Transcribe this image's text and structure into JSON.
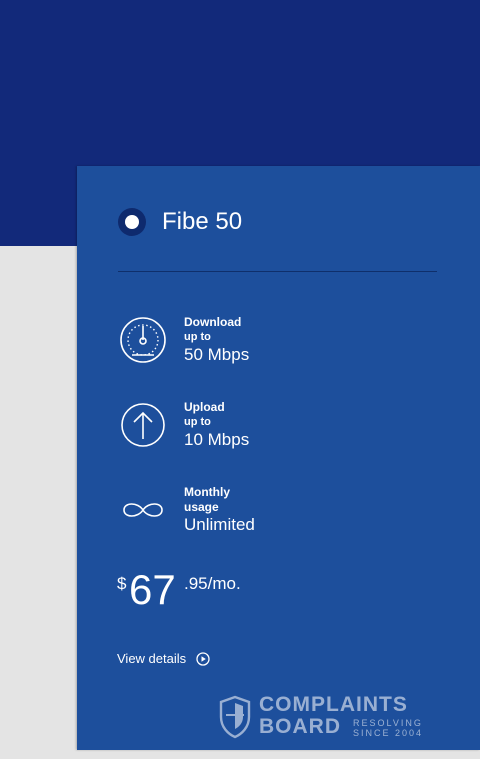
{
  "colors": {
    "banner": "#12297a",
    "card": "#1d4f9c",
    "page_bg": "#e4e4e4",
    "text": "#ffffff"
  },
  "plan": {
    "name": "Fibe 50",
    "selected": true
  },
  "features": [
    {
      "icon": "speedometer-icon",
      "label_line1": "Download",
      "label_line2": "up to",
      "value": "50 Mbps"
    },
    {
      "icon": "upload-arrow-icon",
      "label_line1": "Upload",
      "label_line2": "up to",
      "value": "10 Mbps"
    },
    {
      "icon": "infinity-icon",
      "label_line1": "Monthly",
      "label_line2": "usage",
      "value": "Unlimited"
    }
  ],
  "price": {
    "currency": "$",
    "dollars": "67",
    "cents_period": ".95/mo."
  },
  "details_link": {
    "label": "View details",
    "icon": "play-circle-icon"
  },
  "watermark": {
    "line1": "COMPLAINTS",
    "line2": "BOARD",
    "tag1": "RESOLVING",
    "tag2": "SINCE 2004"
  }
}
